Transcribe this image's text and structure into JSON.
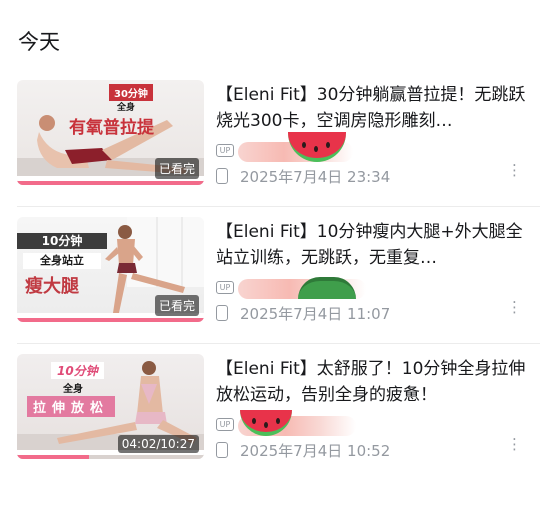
{
  "sections": {
    "today": "今天"
  },
  "items": [
    {
      "title": "【Eleni Fit】30分钟躺赢普拉提！无跳跃烧光300卡，空调房隐形雕刻…",
      "thumb": {
        "tag": "30分钟",
        "line1": "全身",
        "line2": "有氧普拉提",
        "badge": "已看完"
      },
      "meta": "2025年7月4日 23:34"
    },
    {
      "title": "【Eleni Fit】10分钟瘦内大腿+外大腿全站立训练，无跳跃，无重复…",
      "thumb": {
        "tag": "10分钟",
        "line1": "全身站立",
        "line2": "瘦大腿",
        "badge": "已看完"
      },
      "meta": "2025年7月4日 11:07"
    },
    {
      "title": "【Eleni Fit】太舒服了！10分钟全身拉伸放松运动，告别全身的疲惫！",
      "thumb": {
        "tag": "10分钟",
        "line1": "全身",
        "line2": "拉伸放松",
        "badge": "04:02/10:27"
      },
      "meta": "2025年7月4日 10:52"
    }
  ],
  "icons": {
    "up": "up-icon",
    "device": "phone-icon",
    "more": "more-icon"
  },
  "colors": {
    "accent": "#f26b8a",
    "meta": "#9499a0"
  },
  "up_label": "UP",
  "more_glyph": "⋮"
}
